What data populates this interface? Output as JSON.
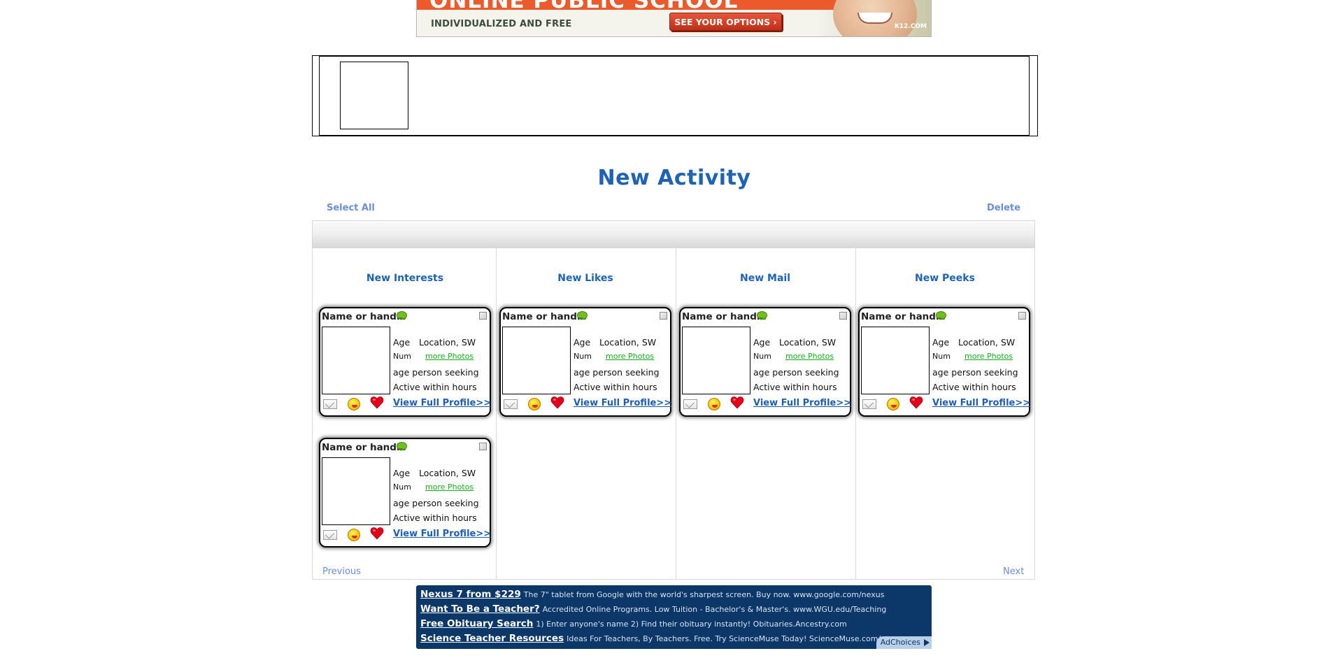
{
  "top_ad": {
    "headline_fragment": "ONLINE PUBLIC SCHOOL",
    "tagline": "INDIVIDUALIZED AND FREE",
    "cta": "SEE YOUR OPTIONS ›",
    "brand": "K12.COM"
  },
  "page": {
    "title": "New Activity",
    "select_all": "Select All",
    "delete": "Delete",
    "previous": "Previous",
    "next": "Next"
  },
  "columns": [
    {
      "title": "New Interests"
    },
    {
      "title": "New Likes"
    },
    {
      "title": "New Mail"
    },
    {
      "title": "New Peeks"
    }
  ],
  "card": {
    "name": "Name or handle",
    "age": "Age",
    "location": "Location, SW",
    "num": "Num",
    "more_photos": "more Photos",
    "seeking": "age person seeking",
    "active": "Active within hours",
    "view_profile": "View Full Profile>>"
  },
  "text_ads": [
    {
      "title": "Nexus 7 from $229",
      "body": "The 7\" tablet from Google with the world's sharpest screen. Buy now. www.google.com/nexus"
    },
    {
      "title": "Want To Be a Teacher?",
      "body": "Accredited Online Programs. Low Tuition - Bachelor's & Master's. www.WGU.edu/Teaching"
    },
    {
      "title": "Free Obituary Search",
      "body": "1) Enter anyone's name 2) Find their obituary instantly! Obituaries.Ancestry.com"
    },
    {
      "title": "Science Teacher Resources",
      "body": "Ideas For Teachers, By Teachers. Free. Try ScienceMuse Today! ScienceMuse.com/"
    }
  ],
  "adchoices": "AdChoices",
  "icons": {
    "message": "mail-icon",
    "wink": "wink-icon",
    "like": "heart-icon",
    "status": "chat-bubble-icon",
    "select": "checkbox-icon"
  },
  "colors": {
    "title_blue": "#1e63b5",
    "link_blue": "#6b8fd8",
    "photo_link_green": "#15b21c",
    "ad_navy": "#0c3769",
    "ad_orange": "#ec5a2c"
  }
}
